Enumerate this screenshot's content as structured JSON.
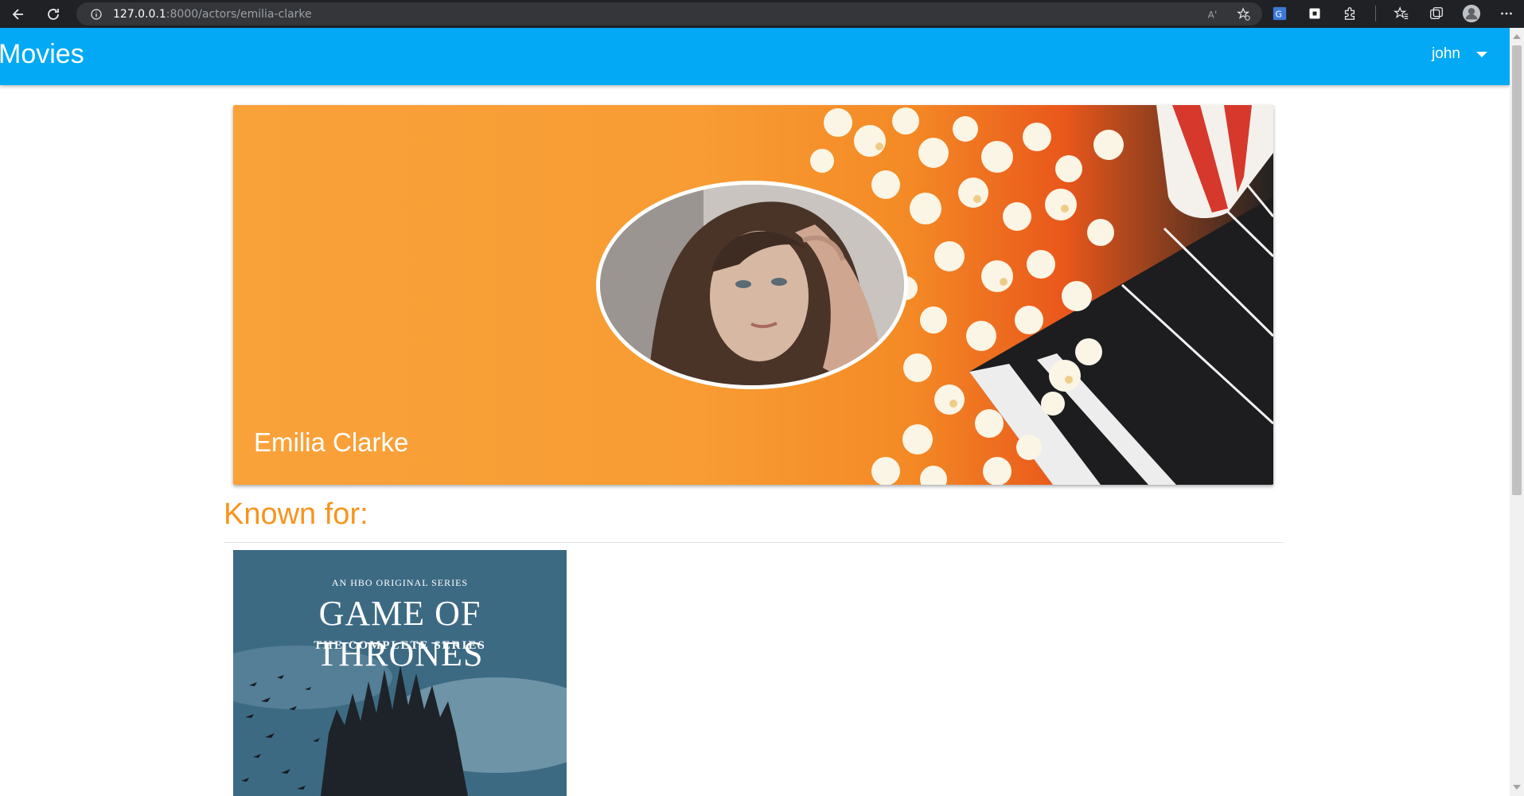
{
  "browser": {
    "url_host": "127.0.0.1",
    "url_rest": ":8000/actors/emilia-clarke",
    "icons": [
      "back-icon",
      "reload-icon",
      "site-info-icon",
      "read-aloud-icon",
      "favorite-add-icon",
      "translate-icon",
      "extension-icon",
      "puzzle-icon",
      "favorites-icon",
      "collections-icon",
      "profile-icon",
      "more-icon"
    ]
  },
  "header": {
    "brand": "Movies",
    "user": "john"
  },
  "actor": {
    "name": "Emilia Clarke"
  },
  "known_for": {
    "title": "Known for:",
    "items": [
      {
        "tagline": "AN HBO ORIGINAL SERIES",
        "title": "GAME OF THRONES",
        "subtitle": "THE COMPLETE SERIES"
      }
    ]
  },
  "colors": {
    "header": "#03a9f4",
    "accent": "#f7941d",
    "browser_bar": "#202124"
  }
}
